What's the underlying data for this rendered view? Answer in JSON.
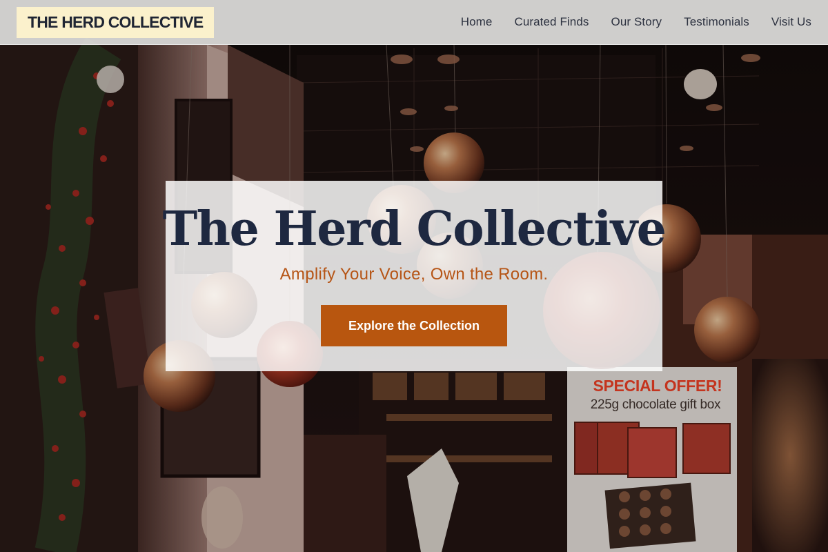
{
  "header": {
    "logo_text": "THE HERD COLLECTIVE",
    "nav": [
      {
        "label": "Home"
      },
      {
        "label": "Curated Finds"
      },
      {
        "label": "Our Story"
      },
      {
        "label": "Testimonials"
      },
      {
        "label": "Visit Us"
      }
    ]
  },
  "hero": {
    "title": "The Herd Collective",
    "tagline": "Amplify Your Voice, Own the Room.",
    "cta_label": "Explore the Collection",
    "background_sign": {
      "headline": "SPECIAL OFFER!",
      "subline": "225g chocolate gift box"
    }
  },
  "colors": {
    "header_bg": "#dededc",
    "logo_bg": "#fbf1cc",
    "title": "#1e2840",
    "tagline": "#b65516",
    "cta_bg": "#b8560f",
    "cta_text": "#ffffff"
  }
}
